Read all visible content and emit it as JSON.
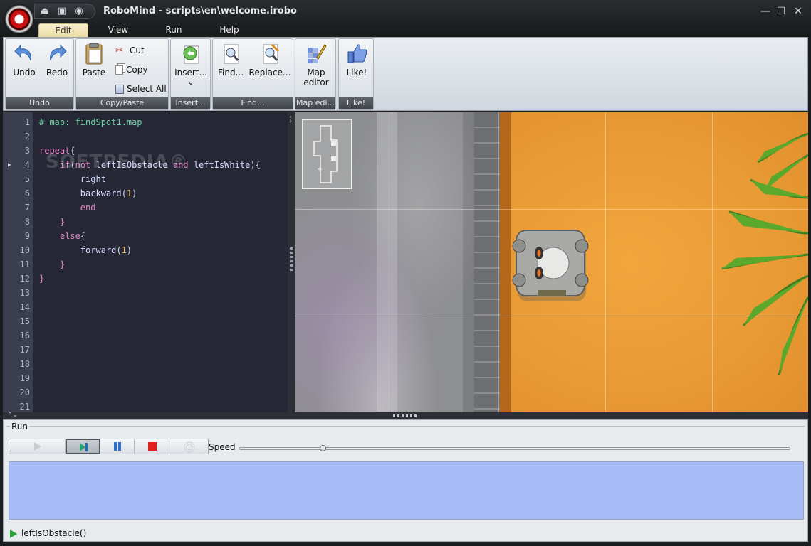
{
  "window": {
    "title": "RoboMind - scripts\\en\\welcome.irobo",
    "controls": {
      "minimize": "—",
      "maximize": "☐",
      "close": "✕"
    }
  },
  "quick_access": [
    "open-icon",
    "save-icon",
    "web-icon"
  ],
  "tabs": [
    {
      "label": "Edit",
      "active": true
    },
    {
      "label": "View",
      "active": false
    },
    {
      "label": "Run",
      "active": false
    },
    {
      "label": "Help",
      "active": false
    }
  ],
  "ribbon": {
    "undo_group": {
      "caption": "Undo",
      "undo": "Undo",
      "redo": "Redo"
    },
    "clipboard_group": {
      "caption": "Copy/Paste",
      "paste": "Paste",
      "cut": "Cut",
      "copy": "Copy",
      "select_all": "Select All"
    },
    "insert_group": {
      "caption": "Insert...",
      "insert": "Insert...",
      "dropdown": "⌄"
    },
    "find_group": {
      "caption": "Find...",
      "find": "Find...",
      "replace": "Replace..."
    },
    "map_group": {
      "caption": "Map edi...",
      "map_editor_line1": "Map",
      "map_editor_line2": "editor"
    },
    "like_group": {
      "caption": "Like!",
      "like": "Like!"
    }
  },
  "editor": {
    "current_line": 4,
    "line_numbers": [
      "1",
      "2",
      "3",
      "4",
      "5",
      "6",
      "7",
      "8",
      "9",
      "10",
      "11",
      "12",
      "13",
      "14",
      "15",
      "16",
      "17",
      "18",
      "19",
      "20",
      "21"
    ],
    "watermark": "SOFTPEDIA®",
    "lines": [
      [
        [
          "cm",
          "# map: findSpot1.map"
        ]
      ],
      [],
      [
        [
          "kw",
          "repeat"
        ],
        [
          "pu",
          "{"
        ]
      ],
      [
        [
          "pu",
          "    "
        ],
        [
          "kw",
          "if"
        ],
        [
          "pu",
          "("
        ],
        [
          "kw",
          "not"
        ],
        [
          "pu",
          " "
        ],
        [
          "fn",
          "leftIsObstacle"
        ],
        [
          "pu",
          " "
        ],
        [
          "kw",
          "and"
        ],
        [
          "pu",
          " "
        ],
        [
          "fn",
          "leftIsWhite"
        ],
        [
          "pu",
          "){"
        ]
      ],
      [
        [
          "pu",
          "        "
        ],
        [
          "fn",
          "right"
        ]
      ],
      [
        [
          "pu",
          "        "
        ],
        [
          "fn",
          "backward"
        ],
        [
          "pu",
          "("
        ],
        [
          "nm",
          "1"
        ],
        [
          "pu",
          ")"
        ]
      ],
      [
        [
          "pu",
          "        "
        ],
        [
          "kw",
          "end"
        ]
      ],
      [
        [
          "pu",
          "    "
        ],
        [
          "kw",
          "}"
        ]
      ],
      [
        [
          "pu",
          "    "
        ],
        [
          "kw",
          "else"
        ],
        [
          "pu",
          "{"
        ]
      ],
      [
        [
          "pu",
          "        "
        ],
        [
          "fn",
          "forward"
        ],
        [
          "pu",
          "("
        ],
        [
          "nm",
          "1"
        ],
        [
          "pu",
          ")"
        ]
      ],
      [
        [
          "pu",
          "    "
        ],
        [
          "kw",
          "}"
        ]
      ],
      [
        [
          "kw",
          "}"
        ]
      ]
    ]
  },
  "run_panel": {
    "label": "Run",
    "buttons": [
      {
        "name": "play-icon",
        "active": false
      },
      {
        "name": "step-icon",
        "active": true
      },
      {
        "name": "pause-icon",
        "active": false
      },
      {
        "name": "stop-icon",
        "active": false
      },
      {
        "name": "record-icon",
        "active": false
      }
    ],
    "speed_label": "Speed",
    "speed_fraction": 0.15,
    "status_text": "leftIsObstacle()"
  },
  "colors": {
    "editor_bg": "#252734",
    "gutter_bg": "#3a3e4e",
    "output_bg": "#a7bcf6",
    "sand": "#e89a34",
    "accent_play": "#2da43a"
  }
}
